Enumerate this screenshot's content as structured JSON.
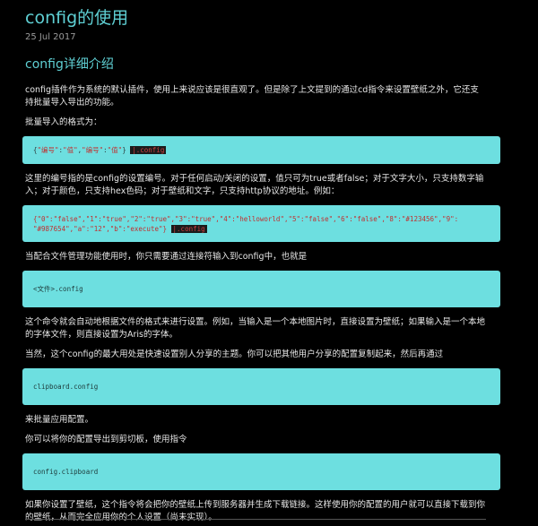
{
  "post": {
    "title": "config的使用",
    "date": "25 Jul 2017"
  },
  "section": {
    "title": "config详细介绍"
  },
  "paragraphs": {
    "p1": "config插件作为系统的默认插件，使用上来说应该是很直观了。但是除了上文提到的通过cd指令来设置壁纸之外，它还支持批量导入导出的功能。",
    "p2": "批量导入的格式为：",
    "p3": "这里的编号指的是config的设置编号。对于任何启动/关闭的设置，值只可为true或者false；对于文字大小，只支持数字输入；对于颜色，只支持hex色码；对于壁纸和文字，只支持http协议的地址。例如：",
    "p4": "当配合文件管理功能使用时，你只需要通过连接符输入到config中，也就是",
    "p5": "这个命令就会自动地根据文件的格式来进行设置。例如，当输入是一个本地图片时，直接设置为壁纸；如果输入是一个本地的字体文件，则直接设置为Aris的字体。",
    "p6": "当然，这个config的最大用处是快速设置别人分享的主题。你可以把其他用户分享的配置复制起来，然后再通过",
    "p7": "来批量应用配置。",
    "p8": "你可以将你的配置导出到剪切板，使用指令",
    "p9": "如果你设置了壁纸，这个指令将会把你的壁纸上传到服务器并生成下载链接。这样使用你的配置的用户就可以直接下载到你的壁纸，从而完全应用你的个人设置（尚未实现）。"
  },
  "code": {
    "format": {
      "open": "{",
      "k1": "\"编号\"",
      "colon1": ":",
      "v1": "\"值\"",
      "comma1": ",",
      "k2": "\"编号\"",
      "colon2": ":",
      "v2": "\"值\"",
      "close": "} ",
      "cmd": "|.config"
    },
    "example_line1": "{\"0\":\"false\",\"1\":\"true\",\"2\":\"true\",\"3\":\"true\",\"4\":\"helloworld\",\"5\":\"false\",\"6\":\"false\",\"8\":\"#123456\",\"9\":",
    "example_line2_text": "\"#987654\",\"a\":\"12\",\"b\":\"execute\"} ",
    "example_line2_cmd": "|.config",
    "file_config": "<文件>.config",
    "clipboard_config": "clipboard.config",
    "config_clipboard": "config.clipboard"
  }
}
